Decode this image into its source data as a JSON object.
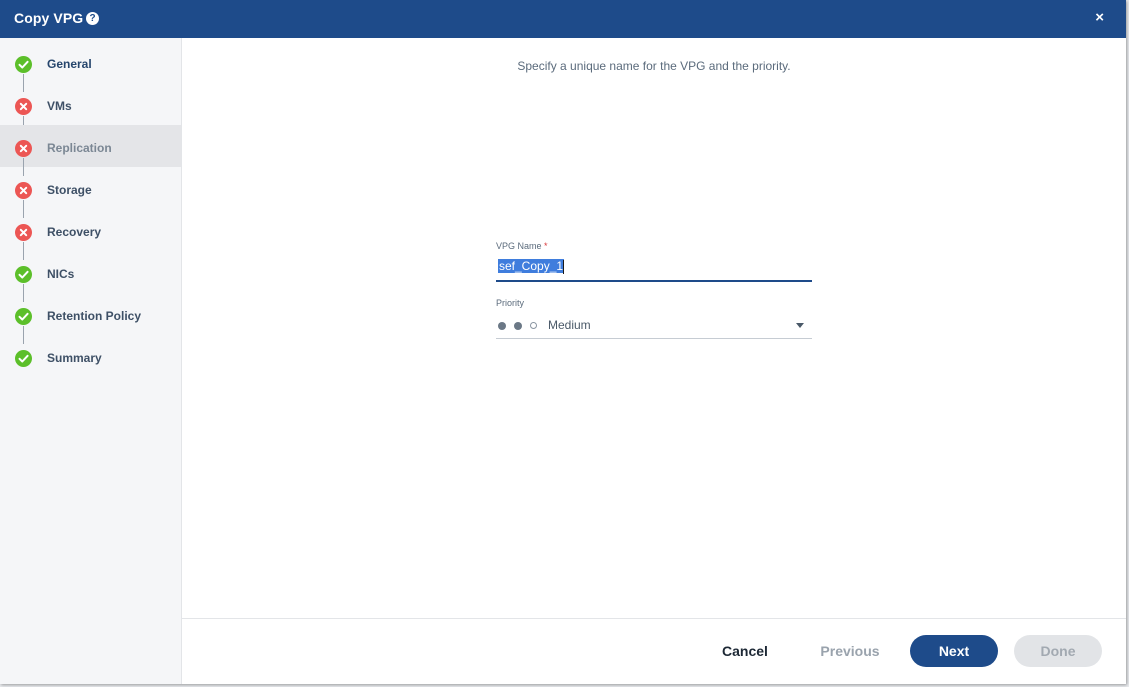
{
  "window": {
    "title": "Copy VPG",
    "help_icon": "question-circle-icon",
    "close_icon": "close-icon",
    "close_glyph": "×",
    "help_glyph": "?"
  },
  "colors": {
    "header": "#1e4b8a",
    "success": "#5cbf2a",
    "error": "#ec5654",
    "primary": "#1e4b8a",
    "selection": "#3f7ddd"
  },
  "steps": [
    {
      "label": "General",
      "status": "valid"
    },
    {
      "label": "VMs",
      "status": "error"
    },
    {
      "label": "Replication",
      "status": "error",
      "active": true
    },
    {
      "label": "Storage",
      "status": "error"
    },
    {
      "label": "Recovery",
      "status": "error"
    },
    {
      "label": "NICs",
      "status": "valid"
    },
    {
      "label": "Retention Policy",
      "status": "valid"
    },
    {
      "label": "Summary",
      "status": "valid"
    }
  ],
  "main": {
    "hint": "Specify a unique name for the VPG and the priority.",
    "vpg_name": {
      "label": "VPG Name",
      "required_mark": "*",
      "value": "sef_Copy_1"
    },
    "priority": {
      "label": "Priority",
      "value": "Medium",
      "level": 2,
      "max_level": 3
    }
  },
  "footer": {
    "cancel": "Cancel",
    "previous": "Previous",
    "next": "Next",
    "done": "Done"
  }
}
